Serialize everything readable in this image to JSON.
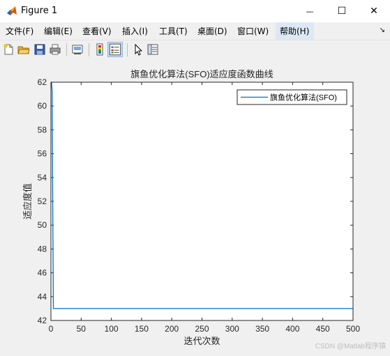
{
  "window": {
    "title": "Figure 1",
    "minimize_label": "—",
    "maximize_label": "☐",
    "close_label": "✕"
  },
  "menu": {
    "items": [
      "文件(F)",
      "编辑(E)",
      "查看(V)",
      "插入(I)",
      "工具(T)",
      "桌面(D)",
      "窗口(W)",
      "帮助(H)"
    ],
    "overflow_label": "↘"
  },
  "toolbar": {
    "icons": [
      "new-figure-icon",
      "open-file-icon",
      "save-icon",
      "print-icon",
      "link-plot-icon",
      "insert-colorbar-icon",
      "insert-legend-icon",
      "pointer-icon",
      "property-inspector-icon"
    ]
  },
  "chart_data": {
    "type": "line",
    "title": "旗鱼优化算法(SFO)适应度函数曲线",
    "xlabel": "迭代次数",
    "ylabel": "适应度值",
    "xlim": [
      0,
      500
    ],
    "ylim": [
      42,
      62
    ],
    "xticks": [
      0,
      50,
      100,
      150,
      200,
      250,
      300,
      350,
      400,
      450,
      500
    ],
    "yticks": [
      42,
      44,
      46,
      48,
      50,
      52,
      54,
      56,
      58,
      60,
      62
    ],
    "grid": false,
    "legend_position": "top-right",
    "series": [
      {
        "name": "旗鱼优化算法(SFO)",
        "color": "#0072bd",
        "x": [
          1,
          2,
          3,
          4,
          500
        ],
        "y": [
          62.0,
          61.2,
          52.0,
          43.0,
          43.0
        ]
      }
    ]
  },
  "watermark": "CSDN @Matlab程序猿"
}
